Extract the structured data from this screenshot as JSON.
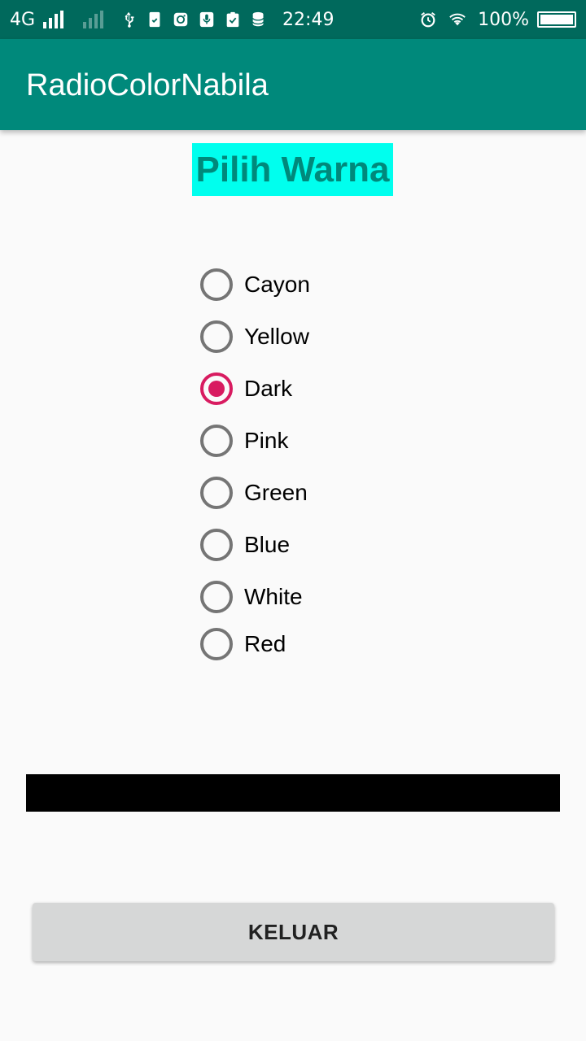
{
  "status_bar": {
    "network": "4G",
    "time": "22:49",
    "battery_text": "100%",
    "battery_level": 1.0
  },
  "app_bar": {
    "title": "RadioColorNabila"
  },
  "heading": {
    "text": "Pilih Warna",
    "background": "#00ffee",
    "color": "#00897b"
  },
  "radio_options": [
    {
      "label": "Cayon",
      "checked": false
    },
    {
      "label": "Yellow",
      "checked": false
    },
    {
      "label": "Dark",
      "checked": true
    },
    {
      "label": "Pink",
      "checked": false
    },
    {
      "label": "Green",
      "checked": false
    },
    {
      "label": "Blue",
      "checked": false
    },
    {
      "label": "White",
      "checked": false
    },
    {
      "label": "Red",
      "checked": false
    }
  ],
  "selected_color": "#000000",
  "exit_button": {
    "label": "KELUAR"
  },
  "colors": {
    "primary": "#00897b",
    "primary_dark": "#00695c",
    "accent": "#d81b60"
  }
}
